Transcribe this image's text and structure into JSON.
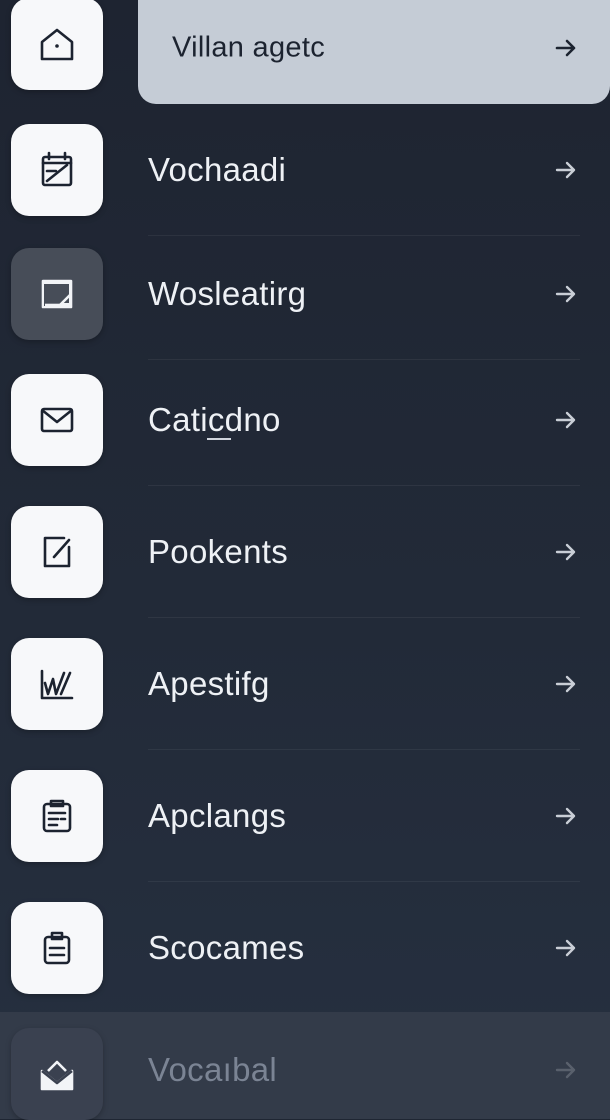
{
  "menu": {
    "items": [
      {
        "label": "Villan agetc",
        "icon": "home-icon",
        "active": true
      },
      {
        "label": "Vochaadi",
        "icon": "calendar-edit-icon"
      },
      {
        "label": "Wosleatirg",
        "icon": "document-corner-icon"
      },
      {
        "label": "Caticdno",
        "icon": "mail-icon"
      },
      {
        "label": "Pookents",
        "icon": "edit-square-icon"
      },
      {
        "label": "Apestifg",
        "icon": "chart-scribble-icon"
      },
      {
        "label": "Apclangs",
        "icon": "clipboard-list-icon"
      },
      {
        "label": "Scocames",
        "icon": "clipboard-icon"
      },
      {
        "label": "Vocaıbal",
        "icon": "mailbox-icon",
        "faded": true
      }
    ]
  },
  "colors": {
    "background": "#1f2633",
    "active_pill": "#c5ccd6",
    "icon_tile": "#f7f8fa",
    "text": "#eef1f5"
  }
}
